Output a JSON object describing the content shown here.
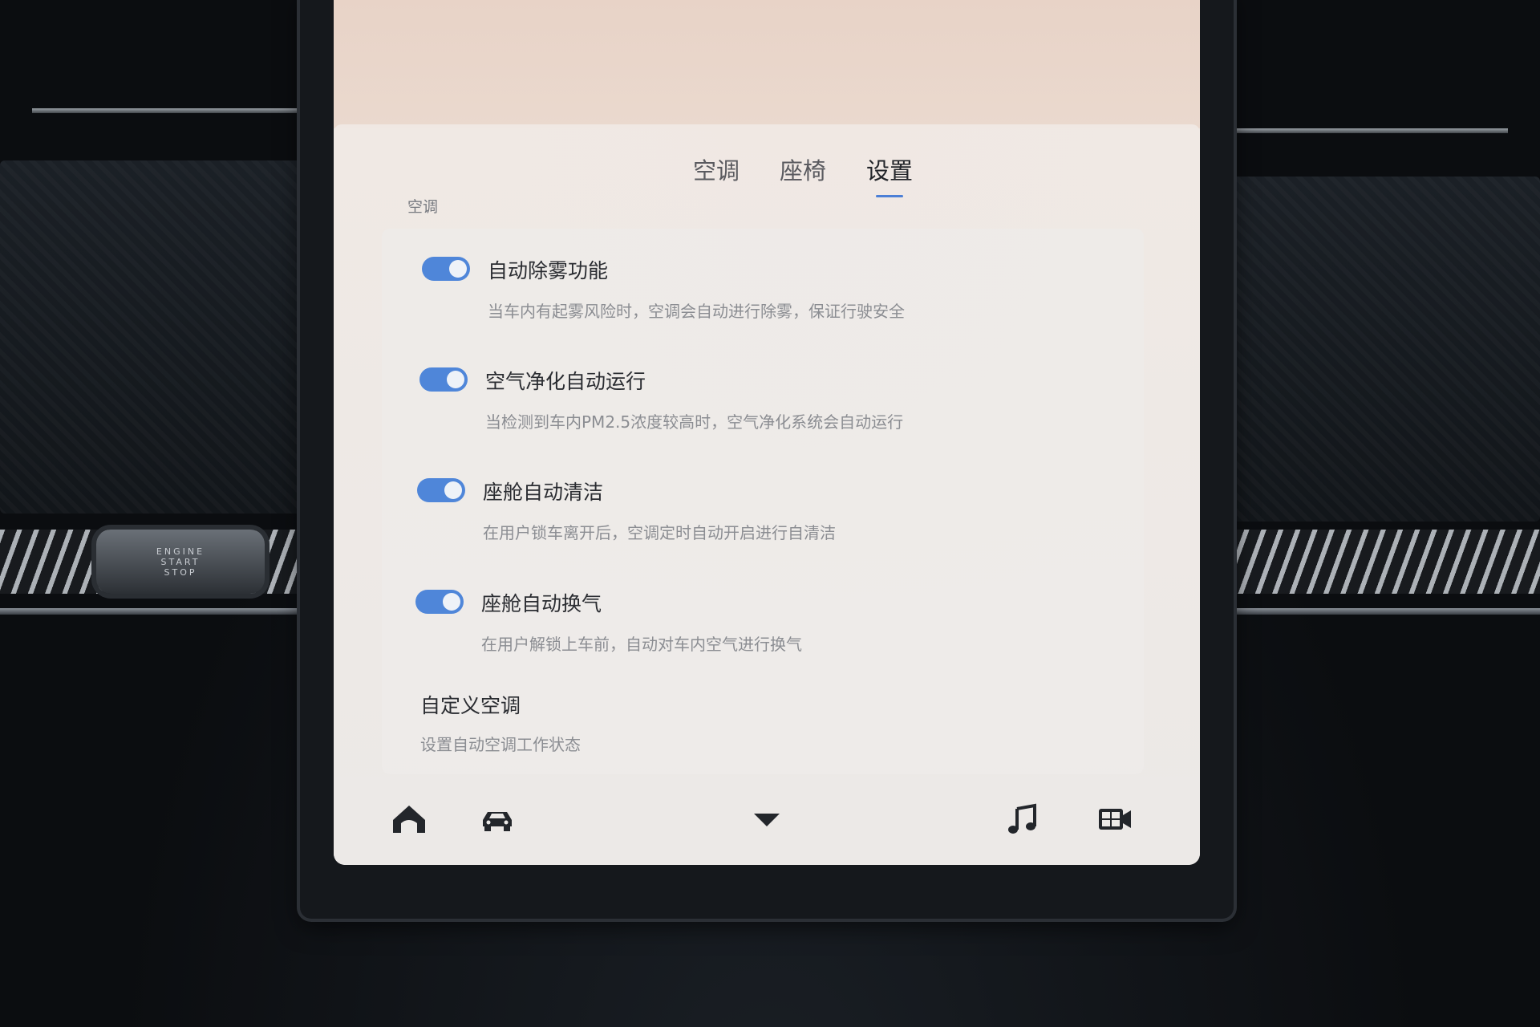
{
  "tabs": [
    {
      "label": "空调",
      "active": false
    },
    {
      "label": "座椅",
      "active": false
    },
    {
      "label": "设置",
      "active": true
    }
  ],
  "section": {
    "label": "空调"
  },
  "settings": [
    {
      "title": "自动除雾功能",
      "description": "当车内有起雾风险时，空调会自动进行除雾，保证行驶安全",
      "enabled": true
    },
    {
      "title": "空气净化自动运行",
      "description": "当检测到车内PM2.5浓度较高时，空气净化系统会自动运行",
      "enabled": true
    },
    {
      "title": "座舱自动清洁",
      "description": "在用户锁车离开后，空调定时自动开启进行自清洁",
      "enabled": true
    },
    {
      "title": "座舱自动换气",
      "description": "在用户解锁上车前，自动对车内空气进行换气",
      "enabled": true
    }
  ],
  "custom": {
    "title": "自定义空调",
    "description": "设置自动空调工作状态"
  },
  "bottom_nav": [
    "home-icon",
    "car-icon",
    "collapse-icon",
    "music-icon",
    "video-icon"
  ],
  "dashboard": {
    "start_button": [
      "ENGINE",
      "START",
      "STOP"
    ]
  },
  "colors": {
    "accent": "#4f86d9",
    "tab_indicator": "#4c7fd6"
  }
}
